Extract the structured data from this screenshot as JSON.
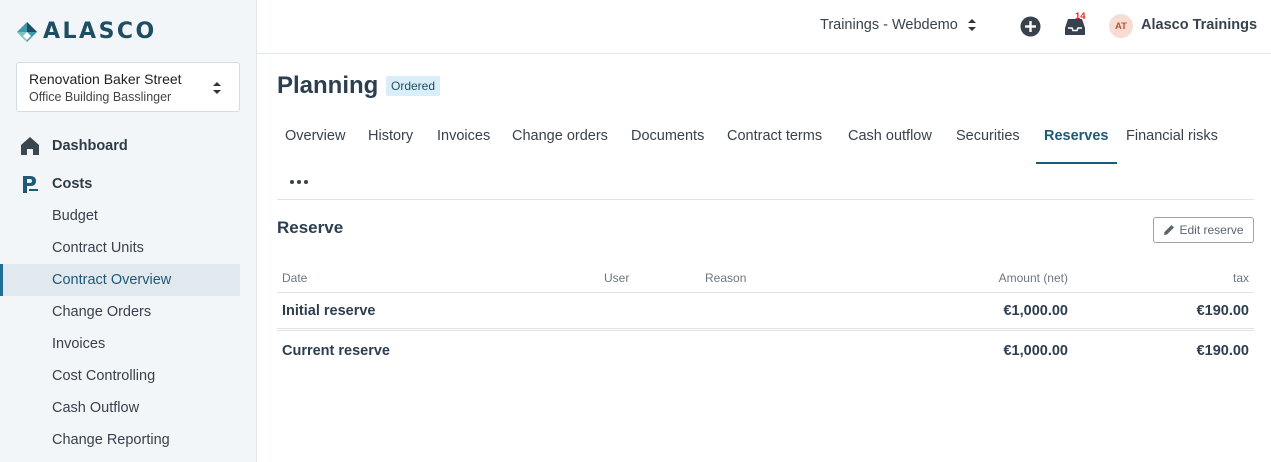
{
  "brand": {
    "name": "ALASCO"
  },
  "project": {
    "title": "Renovation Baker Street",
    "subtitle": "Office Building Basslinger"
  },
  "nav": {
    "dashboard": "Dashboard",
    "costs": "Costs",
    "sub_items": [
      {
        "label": "Budget"
      },
      {
        "label": "Contract Units"
      },
      {
        "label": "Contract Overview"
      },
      {
        "label": "Change Orders"
      },
      {
        "label": "Invoices"
      },
      {
        "label": "Cost Controlling"
      },
      {
        "label": "Cash Outflow"
      },
      {
        "label": "Change Reporting"
      }
    ]
  },
  "header": {
    "org": "Trainings - Webdemo",
    "notification_count": "14",
    "avatar_initials": "AT",
    "user_name": "Alasco Trainings"
  },
  "page": {
    "title": "Planning",
    "status": "Ordered"
  },
  "tabs": [
    {
      "label": "Overview"
    },
    {
      "label": "History"
    },
    {
      "label": "Invoices"
    },
    {
      "label": "Change orders"
    },
    {
      "label": "Documents"
    },
    {
      "label": "Contract terms"
    },
    {
      "label": "Cash outflow"
    },
    {
      "label": "Securities"
    },
    {
      "label": "Reserves"
    },
    {
      "label": "Financial risks"
    }
  ],
  "reserve": {
    "title": "Reserve",
    "edit_label": "Edit reserve",
    "columns": {
      "date": "Date",
      "user": "User",
      "reason": "Reason",
      "amount": "Amount (net)",
      "tax": "tax"
    },
    "rows": [
      {
        "label": "Initial reserve",
        "amount": "€1,000.00",
        "tax": "€190.00"
      },
      {
        "label": "Current reserve",
        "amount": "€1,000.00",
        "tax": "€190.00"
      }
    ]
  },
  "colors": {
    "accent": "#1d5a78",
    "brand": "#1d4e63",
    "sidebar_bg": "#f3f6f8",
    "badge": "#d0311e"
  }
}
